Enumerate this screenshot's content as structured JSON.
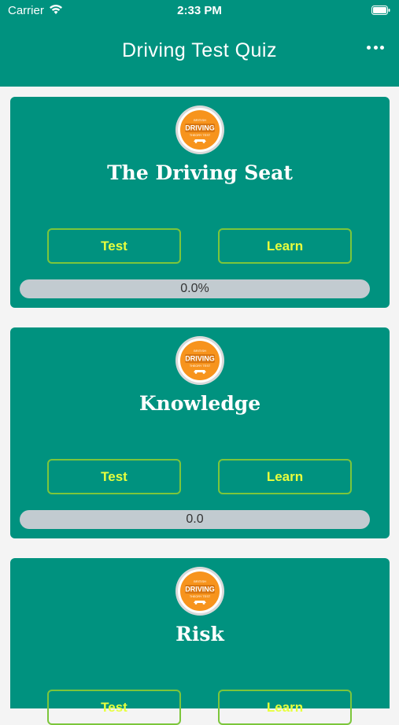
{
  "status_bar": {
    "carrier": "Carrier",
    "time": "2:33 PM"
  },
  "header": {
    "title": "Driving Test Quiz",
    "menu_icon": "more-horizontal-icon"
  },
  "logo": {
    "top_text": "BRITISH",
    "main_text": "DRIVING",
    "sub_text": "THEORY TEST",
    "colors": {
      "orange": "#f7941d",
      "rim": "#ffffff"
    }
  },
  "cards": [
    {
      "title": "The Driving Seat",
      "test_label": "Test",
      "learn_label": "Learn",
      "progress_text": "0.0%",
      "progress_fraction": 0
    },
    {
      "title": "Knowledge",
      "test_label": "Test",
      "learn_label": "Learn",
      "progress_text": "0.0",
      "progress_fraction": 0
    },
    {
      "title": "Risk",
      "test_label": "Test",
      "learn_label": "Learn"
    }
  ],
  "colors": {
    "primary": "#00927f",
    "button_text": "#e8ff3d",
    "button_border": "#7cc63b",
    "progress_track": "#c2cbd0"
  }
}
